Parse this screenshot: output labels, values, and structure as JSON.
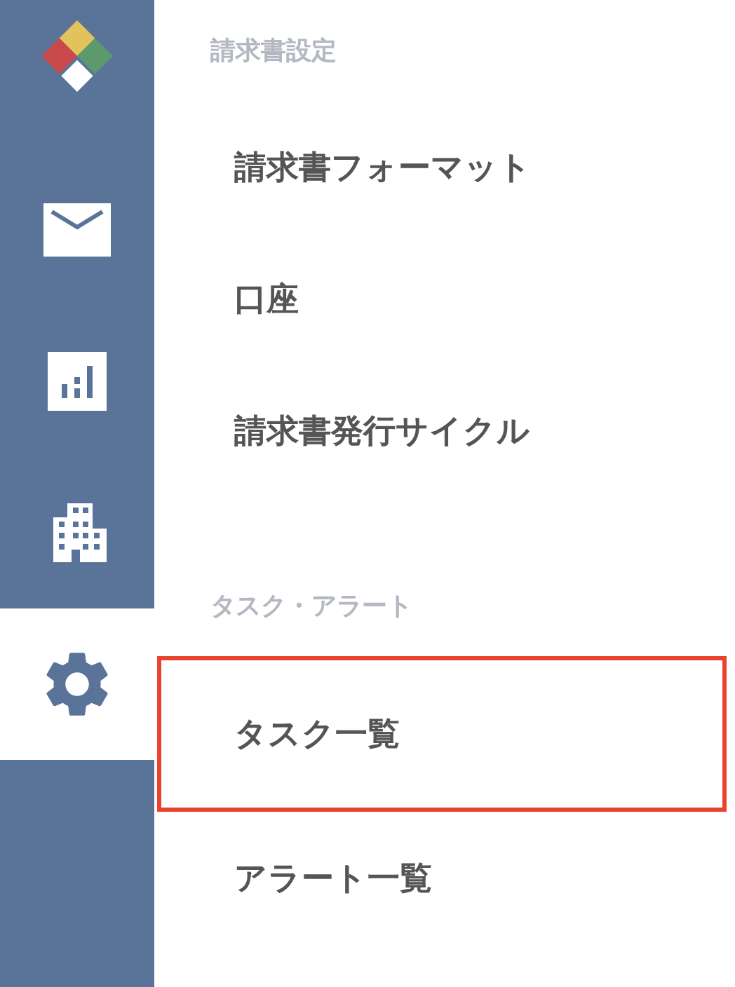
{
  "sidebar": {
    "items": [
      {
        "kind": "logo",
        "selected": false
      },
      {
        "kind": "mail",
        "selected": false
      },
      {
        "kind": "chart",
        "selected": false
      },
      {
        "kind": "building",
        "selected": false
      },
      {
        "kind": "settings",
        "selected": true
      }
    ]
  },
  "menu": {
    "sections": [
      {
        "title": "請求書設定",
        "items": [
          {
            "label": "請求書フォーマット",
            "selected": false
          },
          {
            "label": "口座",
            "selected": false
          },
          {
            "label": "請求書発行サイクル",
            "selected": false
          }
        ]
      },
      {
        "title": "タスク・アラート",
        "items": [
          {
            "label": "タスク一覧",
            "selected": true
          },
          {
            "label": "アラート一覧",
            "selected": false
          }
        ]
      }
    ]
  }
}
